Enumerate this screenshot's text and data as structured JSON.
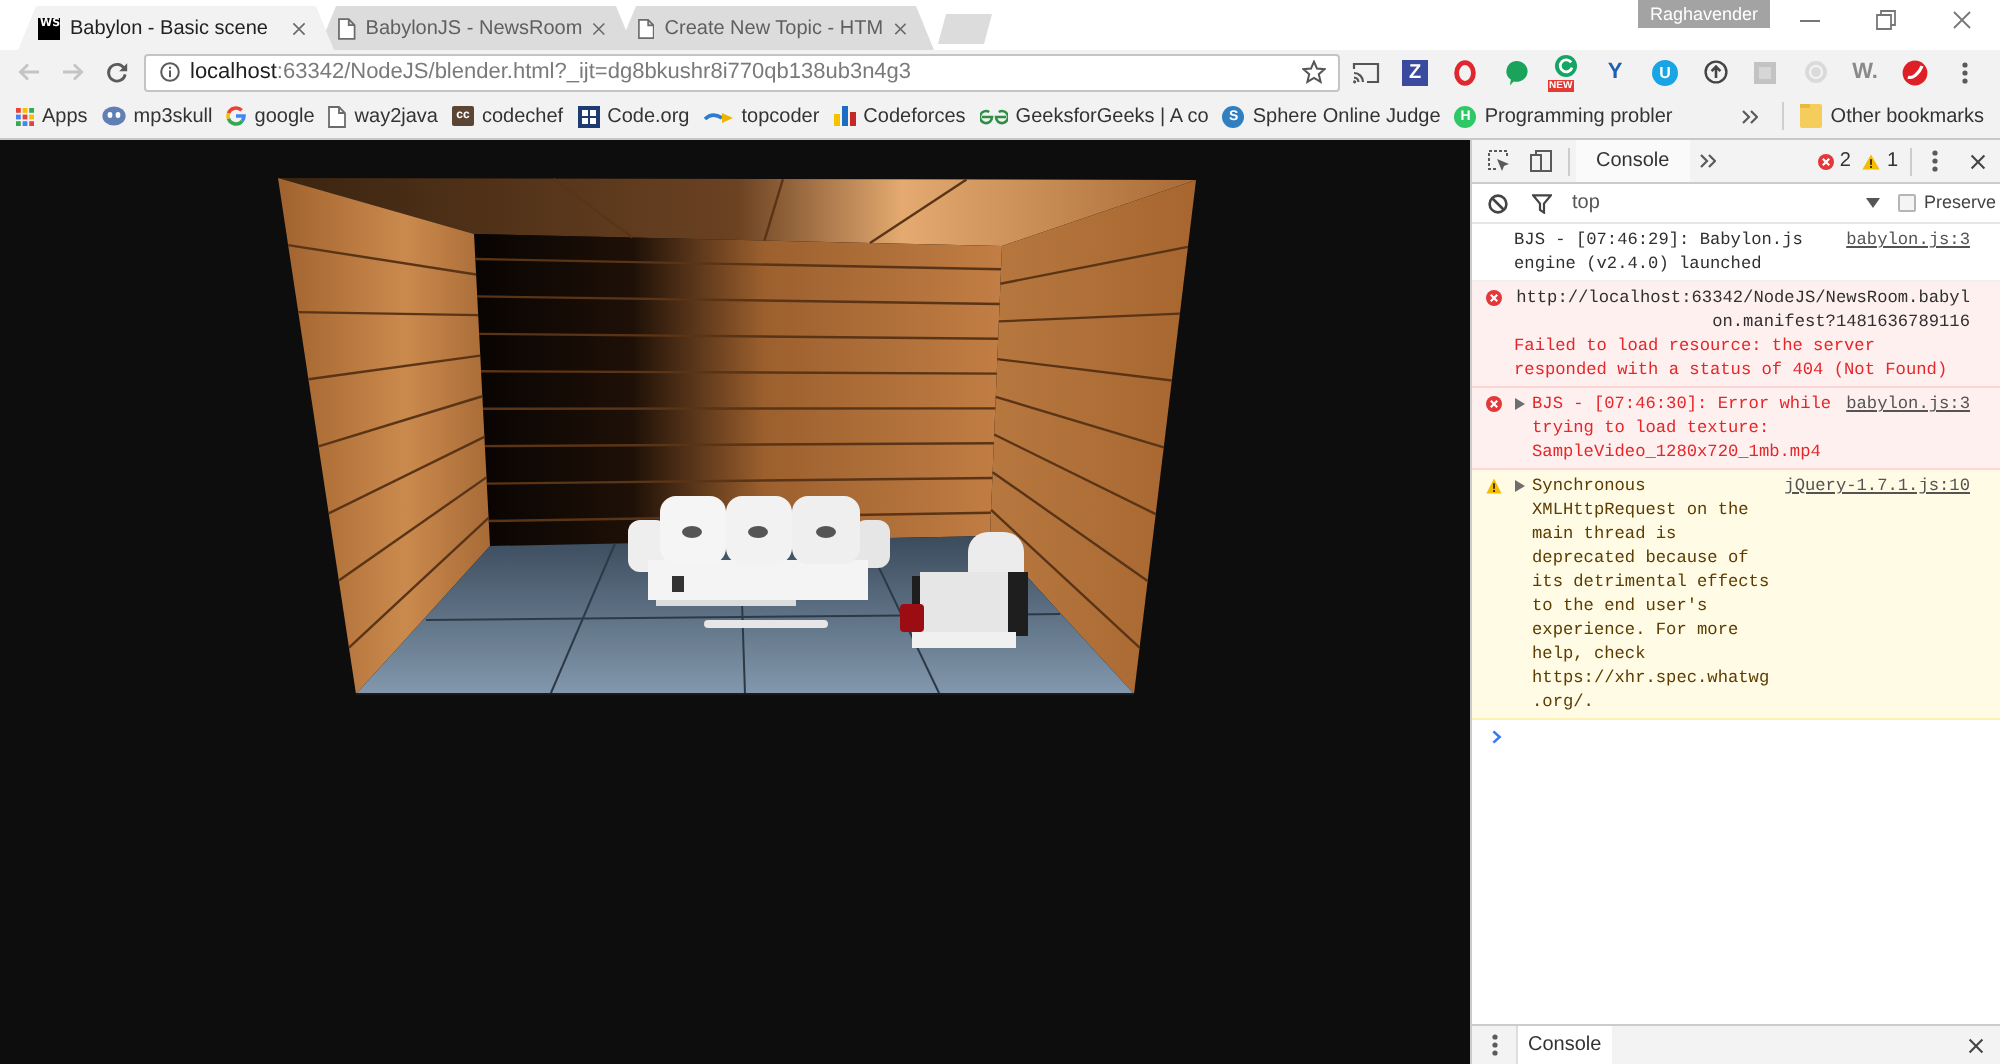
{
  "window": {
    "profile": "Raghavender"
  },
  "tabs": [
    {
      "title": "Babylon - Basic scene",
      "selected": true,
      "favicon": {
        "kind": "logo",
        "glyph": "WS"
      }
    },
    {
      "title": "BabylonJS - NewsRoom",
      "selected": false,
      "favicon": {
        "kind": "page"
      }
    },
    {
      "title": "Create New Topic - HTM",
      "selected": false,
      "favicon": {
        "kind": "page"
      }
    }
  ],
  "navigation": {
    "back": {
      "disabled": true
    },
    "forward": {
      "disabled": true
    }
  },
  "address_bar": {
    "host": "localhost",
    "path": ":63342/NodeJS/blender.html?_ijt=dg8bkushr8i770qb138ub3n4g3",
    "bookmarked": false
  },
  "extensions": [
    {
      "kind": "cast"
    },
    {
      "kind": "square-letter",
      "glyph": "Z"
    },
    {
      "kind": "ring"
    },
    {
      "kind": "bubble"
    },
    {
      "kind": "ring-badge",
      "badge": "NEW"
    },
    {
      "kind": "letter",
      "glyph": "Y",
      "color": "#1d5fb4"
    },
    {
      "kind": "circle-letter",
      "glyph": "U",
      "color": "#19a4e4"
    },
    {
      "kind": "upload"
    },
    {
      "kind": "tile"
    },
    {
      "kind": "disc"
    },
    {
      "kind": "letter",
      "glyph": "W.",
      "color": "#8a8a8a"
    },
    {
      "kind": "swoosh"
    }
  ],
  "bookmarks": [
    {
      "label": "Apps",
      "kind": "apps"
    },
    {
      "label": "mp3skull",
      "kind": "blob"
    },
    {
      "label": "google",
      "kind": "google"
    },
    {
      "label": "way2java",
      "kind": "page"
    },
    {
      "label": "codechef",
      "kind": "letter-tile",
      "glyph": "cc"
    },
    {
      "label": "Code.org",
      "kind": "grid-tile"
    },
    {
      "label": "topcoder",
      "kind": "swoosh"
    },
    {
      "label": "Codeforces",
      "kind": "bars"
    },
    {
      "label": "GeeksforGeeks | A co",
      "kind": "gfg"
    },
    {
      "label": "Sphere Online Judge",
      "kind": "letter-circle",
      "glyph": "S",
      "color": "#2f7fc1"
    },
    {
      "label": "Programming probler",
      "kind": "letter-circle",
      "glyph": "H",
      "color": "#2ec866"
    }
  ],
  "other_bookmarks": {
    "label": "Other bookmarks"
  },
  "devtools": {
    "tabs": [
      {
        "label": "Console",
        "selected": true
      }
    ],
    "error_count": "2",
    "warning_count": "1",
    "context": "top",
    "preserve_log": {
      "label": "Preserve",
      "checked": false
    },
    "messages": [
      {
        "kind": "info",
        "text": "BJS - [07:46:29]: Babylon.js engine (v2.4.0) launched",
        "source": "babylon.js:3"
      },
      {
        "kind": "error",
        "url": "http://localhost:63342/NodeJS/NewsRoom.babylon.manifest?1481636789116",
        "text": "Failed to load resource: the server responded with a status of 404 (Not Found)"
      },
      {
        "kind": "error",
        "expanded": false,
        "text": "BJS - [07:46:30]: Error while trying to load texture: SampleVideo_1280x720_1mb.mp4",
        "source": "babylon.js:3"
      },
      {
        "kind": "warning",
        "expanded": false,
        "text": "Synchronous XMLHttpRequest on the main thread is deprecated because of its detrimental effects to the end user's experience. For more help, check https://xhr.spec.whatwg.org/.",
        "source": "jQuery-1.7.1.js:10"
      }
    ],
    "drawer_tabs": [
      {
        "label": "Console",
        "selected": true
      }
    ]
  }
}
